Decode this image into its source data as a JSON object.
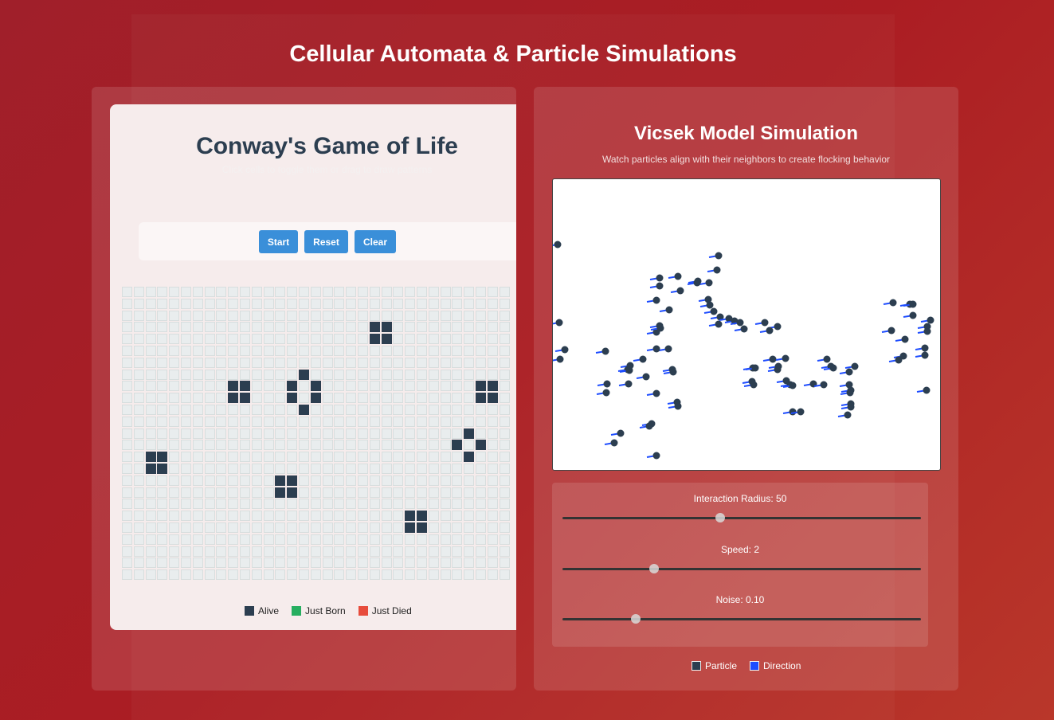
{
  "page": {
    "title": "Cellular Automata & Particle Simulations"
  },
  "game_of_life": {
    "title": "Conway's Game of Life",
    "subtitle": "Click cells to toggle them or drag to draw patterns",
    "buttons": {
      "start": "Start",
      "reset": "Reset",
      "clear": "Clear"
    },
    "grid": {
      "visible_cols": 33,
      "rows": 25,
      "alive_cells": [
        [
          3,
          21
        ],
        [
          3,
          22
        ],
        [
          4,
          21
        ],
        [
          4,
          22
        ],
        [
          7,
          15
        ],
        [
          8,
          9
        ],
        [
          8,
          10
        ],
        [
          8,
          14
        ],
        [
          8,
          16
        ],
        [
          8,
          30
        ],
        [
          8,
          31
        ],
        [
          9,
          9
        ],
        [
          9,
          10
        ],
        [
          9,
          14
        ],
        [
          9,
          16
        ],
        [
          9,
          30
        ],
        [
          9,
          31
        ],
        [
          10,
          15
        ],
        [
          12,
          29
        ],
        [
          13,
          28
        ],
        [
          13,
          30
        ],
        [
          14,
          2
        ],
        [
          14,
          3
        ],
        [
          14,
          29
        ],
        [
          15,
          2
        ],
        [
          15,
          3
        ],
        [
          16,
          13
        ],
        [
          16,
          14
        ],
        [
          17,
          13
        ],
        [
          17,
          14
        ],
        [
          19,
          24
        ],
        [
          19,
          25
        ],
        [
          20,
          24
        ],
        [
          20,
          25
        ]
      ]
    },
    "legend": [
      {
        "label": "Alive",
        "color": "#2c3e50"
      },
      {
        "label": "Just Born",
        "color": "#27ae60"
      },
      {
        "label": "Just Died",
        "color": "#e74c3c"
      }
    ]
  },
  "vicsek": {
    "title": "Vicsek Model Simulation",
    "subtitle": "Watch particles align with their neighbors to create flocking behavior",
    "particles": [
      [
        6,
        82
      ],
      [
        208,
        96
      ],
      [
        206,
        114
      ],
      [
        134,
        124
      ],
      [
        157,
        122
      ],
      [
        182,
        128
      ],
      [
        196,
        130
      ],
      [
        181,
        130
      ],
      [
        134,
        134
      ],
      [
        160,
        140
      ],
      [
        130,
        152
      ],
      [
        146,
        164
      ],
      [
        195,
        151
      ],
      [
        197,
        158
      ],
      [
        202,
        166
      ],
      [
        210,
        173
      ],
      [
        221,
        175
      ],
      [
        228,
        178
      ],
      [
        235,
        180
      ],
      [
        208,
        182
      ],
      [
        240,
        188
      ],
      [
        266,
        180
      ],
      [
        282,
        185
      ],
      [
        272,
        190
      ],
      [
        134,
        184
      ],
      [
        130,
        192
      ],
      [
        135,
        187
      ],
      [
        145,
        213
      ],
      [
        130,
        213
      ],
      [
        66,
        216
      ],
      [
        113,
        226
      ],
      [
        97,
        234
      ],
      [
        94,
        239
      ],
      [
        96,
        240
      ],
      [
        117,
        248
      ],
      [
        150,
        239
      ],
      [
        151,
        242
      ],
      [
        251,
        237
      ],
      [
        254,
        237
      ],
      [
        276,
        226
      ],
      [
        292,
        225
      ],
      [
        283,
        235
      ],
      [
        282,
        239
      ],
      [
        293,
        253
      ],
      [
        298,
        258
      ],
      [
        301,
        259
      ],
      [
        327,
        257
      ],
      [
        340,
        258
      ],
      [
        344,
        226
      ],
      [
        349,
        235
      ],
      [
        352,
        237
      ],
      [
        379,
        235
      ],
      [
        372,
        242
      ],
      [
        250,
        254
      ],
      [
        252,
        258
      ],
      [
        95,
        257
      ],
      [
        68,
        257
      ],
      [
        67,
        268
      ],
      [
        130,
        269
      ],
      [
        156,
        280
      ],
      [
        157,
        285
      ],
      [
        301,
        292
      ],
      [
        311,
        292
      ],
      [
        372,
        258
      ],
      [
        374,
        265
      ],
      [
        373,
        268
      ],
      [
        374,
        282
      ],
      [
        374,
        286
      ],
      [
        370,
        296
      ],
      [
        124,
        307
      ],
      [
        121,
        310
      ],
      [
        85,
        319
      ],
      [
        77,
        331
      ],
      [
        130,
        347
      ],
      [
        8,
        180
      ],
      [
        15,
        214
      ],
      [
        9,
        226
      ],
      [
        427,
        155
      ],
      [
        448,
        157
      ],
      [
        452,
        157
      ],
      [
        452,
        171
      ],
      [
        474,
        177
      ],
      [
        470,
        185
      ],
      [
        470,
        191
      ],
      [
        425,
        190
      ],
      [
        442,
        201
      ],
      [
        467,
        212
      ],
      [
        467,
        221
      ],
      [
        440,
        222
      ],
      [
        434,
        227
      ],
      [
        469,
        265
      ]
    ],
    "sliders": [
      {
        "label": "Interaction Radius: 50",
        "fraction": 0.44
      },
      {
        "label": "Speed: 2",
        "fraction": 0.255
      },
      {
        "label": "Noise: 0.10",
        "fraction": 0.205
      }
    ],
    "legend": [
      {
        "label": "Particle",
        "color": "#2c3e50"
      },
      {
        "label": "Direction",
        "color": "#1e4dff"
      }
    ]
  }
}
